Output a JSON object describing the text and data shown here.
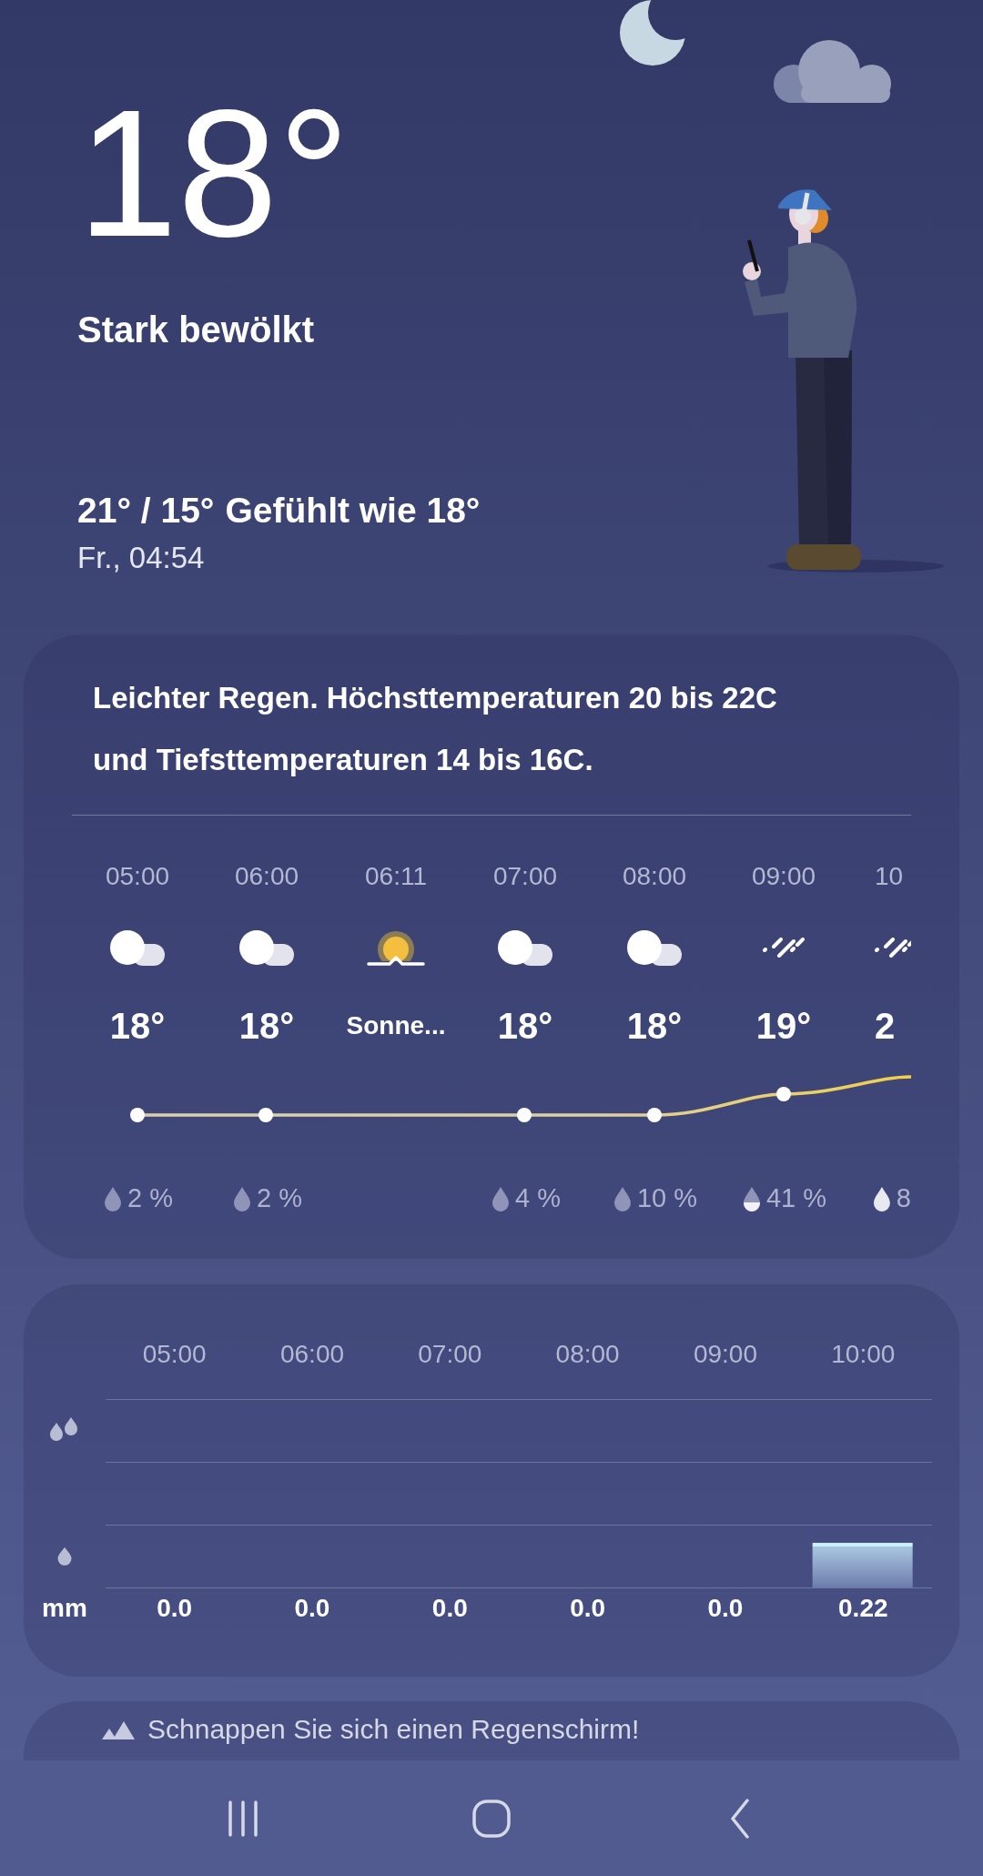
{
  "current": {
    "temperature": "18°",
    "condition": "Stark bewölkt",
    "high_low": "21° / 15°",
    "feels_like": "Gefühlt wie 18°",
    "datetime": "Fr., 04:54"
  },
  "hourly": {
    "summary": "Leichter Regen. Höchsttemperaturen 20 bis 22C und Tiefsttemperaturen 14 bis 16C.",
    "hours": [
      {
        "time": "05:00",
        "kind": "cloudy",
        "temp": "18°",
        "precip": {
          "text": "2 %",
          "kind": "low"
        }
      },
      {
        "time": "06:00",
        "kind": "cloudy",
        "temp": "18°",
        "precip": {
          "text": "2 %",
          "kind": "low"
        }
      },
      {
        "time": "06:11",
        "kind": "sunrise",
        "temp": "Sonne..."
      },
      {
        "time": "07:00",
        "kind": "cloudy",
        "temp": "18°",
        "precip": {
          "text": "4 %",
          "kind": "low"
        }
      },
      {
        "time": "08:00",
        "kind": "cloudy",
        "temp": "18°",
        "precip": {
          "text": "10 %",
          "kind": "low"
        }
      },
      {
        "time": "09:00",
        "kind": "rain",
        "temp": "19°",
        "precip": {
          "text": "41 %",
          "kind": "half"
        }
      },
      {
        "time": "10",
        "kind": "rain",
        "temp": "2",
        "precip": {
          "text": "8",
          "kind": "full"
        }
      }
    ]
  },
  "precipitation": {
    "unit": "mm",
    "chart_data": {
      "type": "bar",
      "categories": [
        "05:00",
        "06:00",
        "07:00",
        "08:00",
        "09:00",
        "10:00"
      ],
      "values": [
        0,
        0,
        0,
        0,
        0,
        0.22
      ],
      "value_labels": [
        "0.0",
        "0.0",
        "0.0",
        "0.0",
        "0.0",
        "0.22"
      ]
    }
  },
  "advice": {
    "text": "Schnappen Sie sich einen Regenschirm!"
  },
  "nav_bar": {
    "buttons": [
      {
        "kind": "recents"
      },
      {
        "kind": "home"
      },
      {
        "kind": "back"
      }
    ]
  }
}
